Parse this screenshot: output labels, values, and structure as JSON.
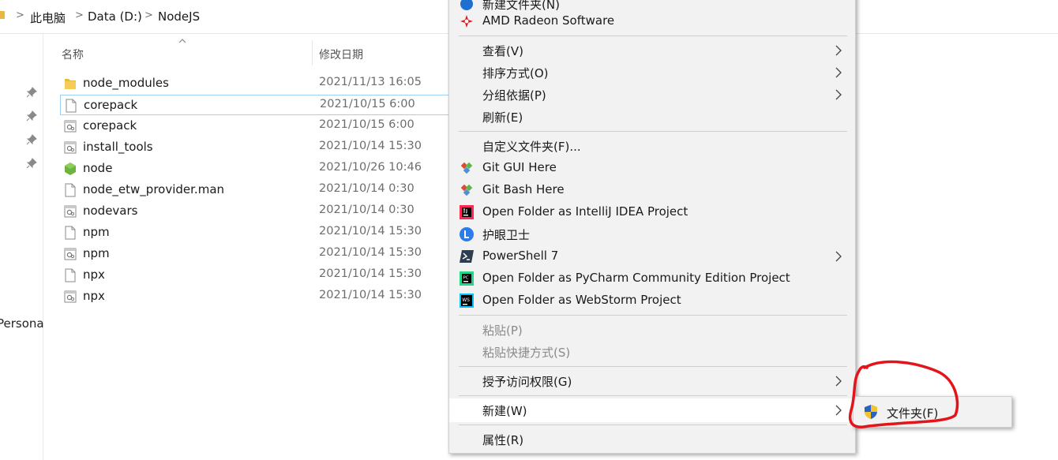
{
  "address_bar": {
    "crumbs": [
      "此电脑",
      "Data (D:)",
      "NodeJS"
    ]
  },
  "nav_pane": {
    "partial_label": "Persona"
  },
  "columns": {
    "name": "名称",
    "date_modified": "修改日期"
  },
  "files": [
    {
      "name": "node_modules",
      "date": "2021/11/13 16:05",
      "icon": "folder-icon"
    },
    {
      "name": "corepack",
      "date": "2021/10/15 6:00",
      "icon": "file-icon"
    },
    {
      "name": "corepack",
      "date": "2021/10/15 6:00",
      "icon": "cmd-script-icon"
    },
    {
      "name": "install_tools",
      "date": "2021/10/14 15:30",
      "icon": "cmd-script-icon"
    },
    {
      "name": "node",
      "date": "2021/10/26 10:46",
      "icon": "node-icon"
    },
    {
      "name": "node_etw_provider.man",
      "date": "2021/10/14 0:30",
      "icon": "file-icon"
    },
    {
      "name": "nodevars",
      "date": "2021/10/14 0:30",
      "icon": "cmd-script-icon"
    },
    {
      "name": "npm",
      "date": "2021/10/14 15:30",
      "icon": "file-icon"
    },
    {
      "name": "npm",
      "date": "2021/10/14 15:30",
      "icon": "cmd-script-icon"
    },
    {
      "name": "npx",
      "date": "2021/10/14 15:30",
      "icon": "file-icon"
    },
    {
      "name": "npx",
      "date": "2021/10/14 15:30",
      "icon": "cmd-script-icon"
    }
  ],
  "context_menu": {
    "items": [
      {
        "label": "新建文件夹(N)",
        "icon": "new-folder-icon"
      },
      {
        "label": "AMD Radeon Software",
        "icon": "amd-icon"
      },
      {
        "label": "查看(V)",
        "submenu": true
      },
      {
        "label": "排序方式(O)",
        "submenu": true
      },
      {
        "label": "分组依据(P)",
        "submenu": true
      },
      {
        "label": "刷新(E)"
      },
      {
        "label": "自定义文件夹(F)..."
      },
      {
        "label": "Git GUI Here",
        "icon": "git-icon"
      },
      {
        "label": "Git Bash Here",
        "icon": "git-icon"
      },
      {
        "label": "Open Folder as IntelliJ IDEA Project",
        "icon": "intellij-icon"
      },
      {
        "label": "护眼卫士",
        "icon": "eye-guard-icon"
      },
      {
        "label": "PowerShell 7",
        "icon": "powershell-icon",
        "submenu": true
      },
      {
        "label": "Open Folder as PyCharm Community Edition Project",
        "icon": "pycharm-icon"
      },
      {
        "label": "Open Folder as WebStorm Project",
        "icon": "webstorm-icon"
      },
      {
        "label": "粘贴(P)",
        "disabled": true
      },
      {
        "label": "粘贴快捷方式(S)",
        "disabled": true
      },
      {
        "label": "授予访问权限(G)",
        "submenu": true
      },
      {
        "label": "新建(W)",
        "submenu": true,
        "highlighted": true
      },
      {
        "label": "属性(R)"
      }
    ]
  },
  "new_submenu": {
    "folder_label": "文件夹(F)",
    "icon": "uac-shield-icon"
  },
  "colors": {
    "menu_bg": "#f2f2f2",
    "annotation_red": "#e2151b",
    "folder_yellow": "#e8b93f",
    "focus_border": "#9ecff5"
  }
}
